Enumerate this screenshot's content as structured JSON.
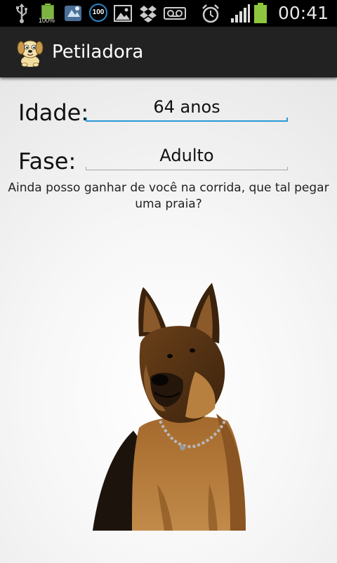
{
  "status_bar": {
    "time": "00:41",
    "battery_percent_label": "100%",
    "badge_label": "100",
    "icons": [
      "usb-icon",
      "battery-100-icon",
      "app-notification-icon",
      "badge-100-icon",
      "image-icon",
      "dropbox-icon",
      "voicemail-icon",
      "alarm-icon",
      "signal-icon",
      "battery-icon"
    ]
  },
  "action_bar": {
    "title": "Petiladora",
    "logo_icon": "dog-logo-icon"
  },
  "form": {
    "age_label": "Idade:",
    "age_value": "64 anos",
    "stage_label": "Fase:",
    "stage_value": "Adulto"
  },
  "message": "Ainda posso ganhar de você na corrida, que tal pegar uma praia?",
  "image": {
    "subject": "german-shepherd-dog"
  },
  "colors": {
    "status_bar_bg": "#000000",
    "action_bar_bg": "#222222",
    "focus_underline": "#2a9ad6",
    "battery_green": "#8dc63f"
  }
}
